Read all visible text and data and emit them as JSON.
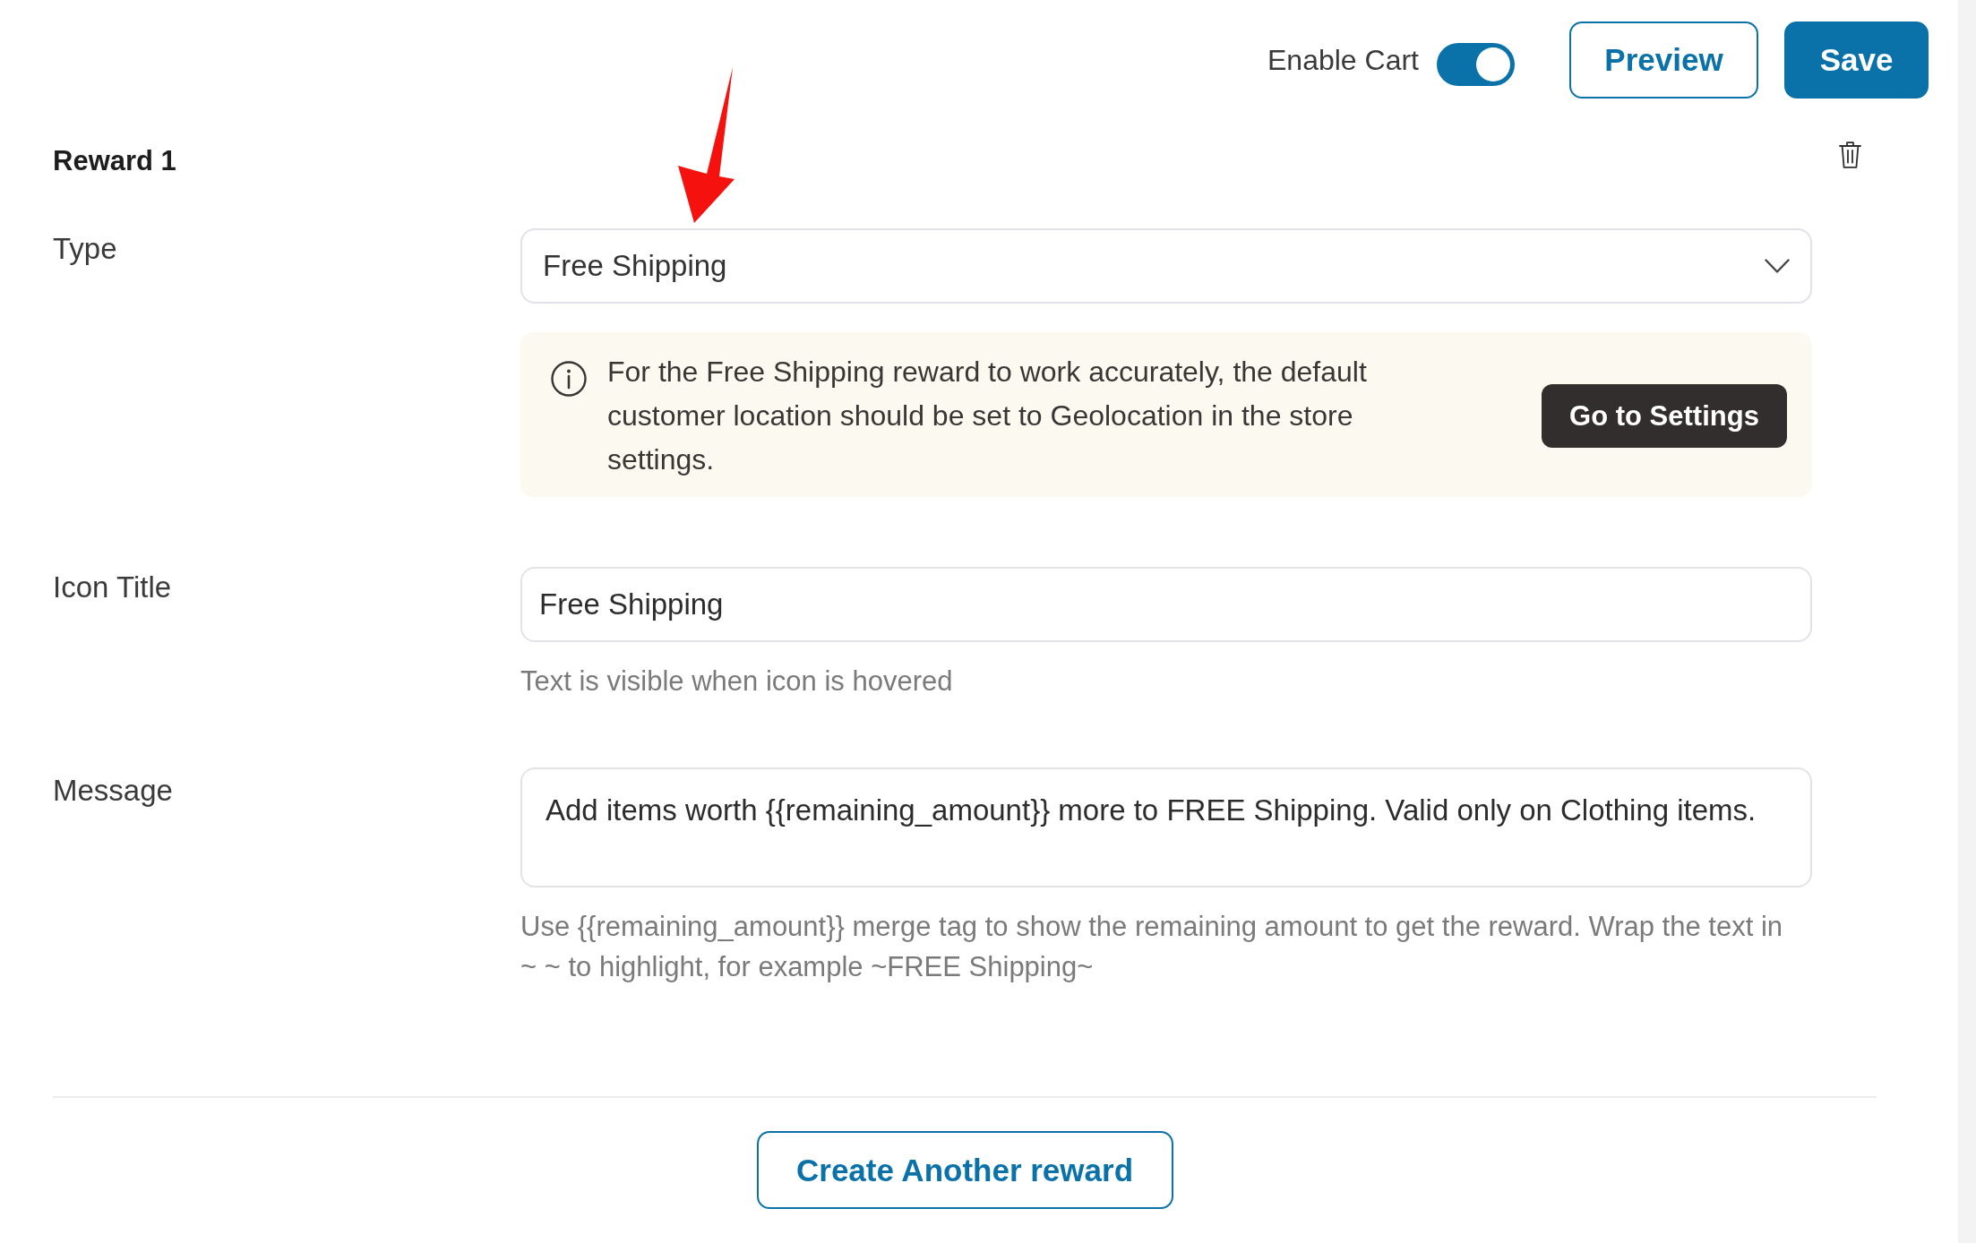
{
  "header": {
    "enable_cart": {
      "label": "Enable Cart",
      "on": true
    },
    "buttons": [
      {
        "label": "Preview",
        "kind": "outline"
      },
      {
        "label": "Save",
        "kind": "primary"
      }
    ]
  },
  "reward": {
    "title": "Reward 1",
    "type": {
      "label": "Type",
      "value": "Free Shipping",
      "notice": {
        "text": "For the Free Shipping reward to work accurately, the default customer location should be set to Geolocation in the store settings.",
        "button": "Go to Settings"
      }
    },
    "icon_title": {
      "label": "Icon Title",
      "value": "Free Shipping",
      "help": "Text is visible when icon is hovered"
    },
    "message": {
      "label": "Message",
      "value": "Add items worth {{remaining_amount}} more to FREE Shipping. Valid only on Clothing items.",
      "help": "Use {{remaining_amount}} merge tag to show the remaining amount to get the reward. Wrap the text in ~ ~ to highlight, for example ~FREE Shipping~"
    }
  },
  "create_button": "Create Another reward"
}
